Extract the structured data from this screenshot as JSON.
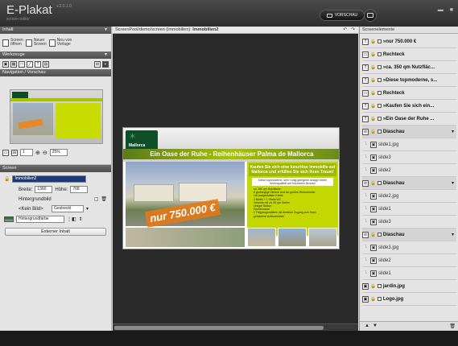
{
  "app": {
    "name": "E-Plakat",
    "version": "v.2.0.1.0",
    "subtitle": "screen editor"
  },
  "toolbar": {
    "preview_label": "VORSCHAU"
  },
  "panels": {
    "inhalt": "Inhalt",
    "werkzeuge": "Werkzeuge",
    "navigation": "Navigation / Vorschau",
    "screen": "Screen",
    "screenelemente": "Screenelemente"
  },
  "inhalt_buttons": [
    {
      "label1": "Screen",
      "label2": "öffnen"
    },
    {
      "label1": "Neuer",
      "label2": "Screen"
    },
    {
      "label1": "Neu von",
      "label2": "Vorlage"
    }
  ],
  "navigation": {
    "zoom": "25%",
    "page": "1"
  },
  "screen": {
    "name": "Immobilien2",
    "breite_label": "Breite:",
    "breite": "1360",
    "hoehe_label": "Höhe:",
    "hoehe": "768",
    "hintergrundbild_label": "Hintergrundbild",
    "kein_bild": "<Kein Bild>",
    "mode": "Gestreckt",
    "hintergrundfarbe": "Hintergrundfarbe",
    "externer_inhalt": "Externer Inhalt"
  },
  "center": {
    "path_label": "ScreenPool/demo/screen (immobilien): ",
    "screen_title": "Immobilien2"
  },
  "poster": {
    "logo_text": "Mallorca",
    "headline": "Ein Oase der Ruhe - Reihenhäuser Palma de Mallorca",
    "promo_line1": "Kaufen Sie sich eine luxuriöse Immobilie auf",
    "promo_line2": "Mallorca und erfüllen Sie sich Ihren Traum!",
    "info_line1": "Diese topmoderne, sehr ruhig gelegene Anlage bietet",
    "info_line2": "Wohnqualität auf höchstem Niveau!",
    "features": [
      "ca. 350 qm Nutzfläche",
      "6 großzügige Zimmer und ein großes Wohnzimmer",
      "voll ausgestattete Küche",
      "3 Bäder + 1 Gäste WC",
      "Veranda mit ca. 50 qm Garten",
      "riesiger Balkon",
      "Dachterrasse",
      "2 Tiefgaragenplätze mit direktem Zugang zum Haus",
      "gehobener Außenbereich"
    ],
    "price": "nur 750.000 €"
  },
  "elements": [
    {
      "type": "T",
      "name": "»nur 750.000 €",
      "group": false,
      "child": false
    },
    {
      "type": "R",
      "name": "Rechteck",
      "group": false,
      "child": false
    },
    {
      "type": "T",
      "name": "»ca. 350 qm Nutzfläc...",
      "group": false,
      "child": false
    },
    {
      "type": "T",
      "name": "»Diese topmoderne, s...",
      "group": false,
      "child": false
    },
    {
      "type": "R",
      "name": "Rechteck",
      "group": false,
      "child": false
    },
    {
      "type": "T",
      "name": "»Kaufen Sie sich ein...",
      "group": false,
      "child": false
    },
    {
      "type": "T",
      "name": "»Ein Oase der Ruhe ...",
      "group": false,
      "child": false
    },
    {
      "type": "D",
      "name": "Diaschau",
      "group": true,
      "child": false
    },
    {
      "type": "M",
      "name": "slide1.jpg",
      "group": false,
      "child": true
    },
    {
      "type": "M",
      "name": "slide3",
      "group": false,
      "child": true
    },
    {
      "type": "M",
      "name": "slide2",
      "group": false,
      "child": true
    },
    {
      "type": "D",
      "name": "Diaschau",
      "group": true,
      "child": false
    },
    {
      "type": "M",
      "name": "slide2.jpg",
      "group": false,
      "child": true
    },
    {
      "type": "M",
      "name": "slide1",
      "group": false,
      "child": true
    },
    {
      "type": "M",
      "name": "slide3",
      "group": false,
      "child": true
    },
    {
      "type": "D",
      "name": "Diaschau",
      "group": true,
      "child": false
    },
    {
      "type": "M",
      "name": "slide3.jpg",
      "group": false,
      "child": true
    },
    {
      "type": "M",
      "name": "slide2",
      "group": false,
      "child": true
    },
    {
      "type": "M",
      "name": "slide1",
      "group": false,
      "child": true
    },
    {
      "type": "M",
      "name": "jardin.jpg",
      "group": false,
      "child": false
    },
    {
      "type": "M",
      "name": "Logo.jpg",
      "group": false,
      "child": false
    }
  ],
  "colors": {
    "accent_green": "#a7c300",
    "poster_bg": "#ffffff",
    "canvas_bg": "#2a2a2a"
  }
}
